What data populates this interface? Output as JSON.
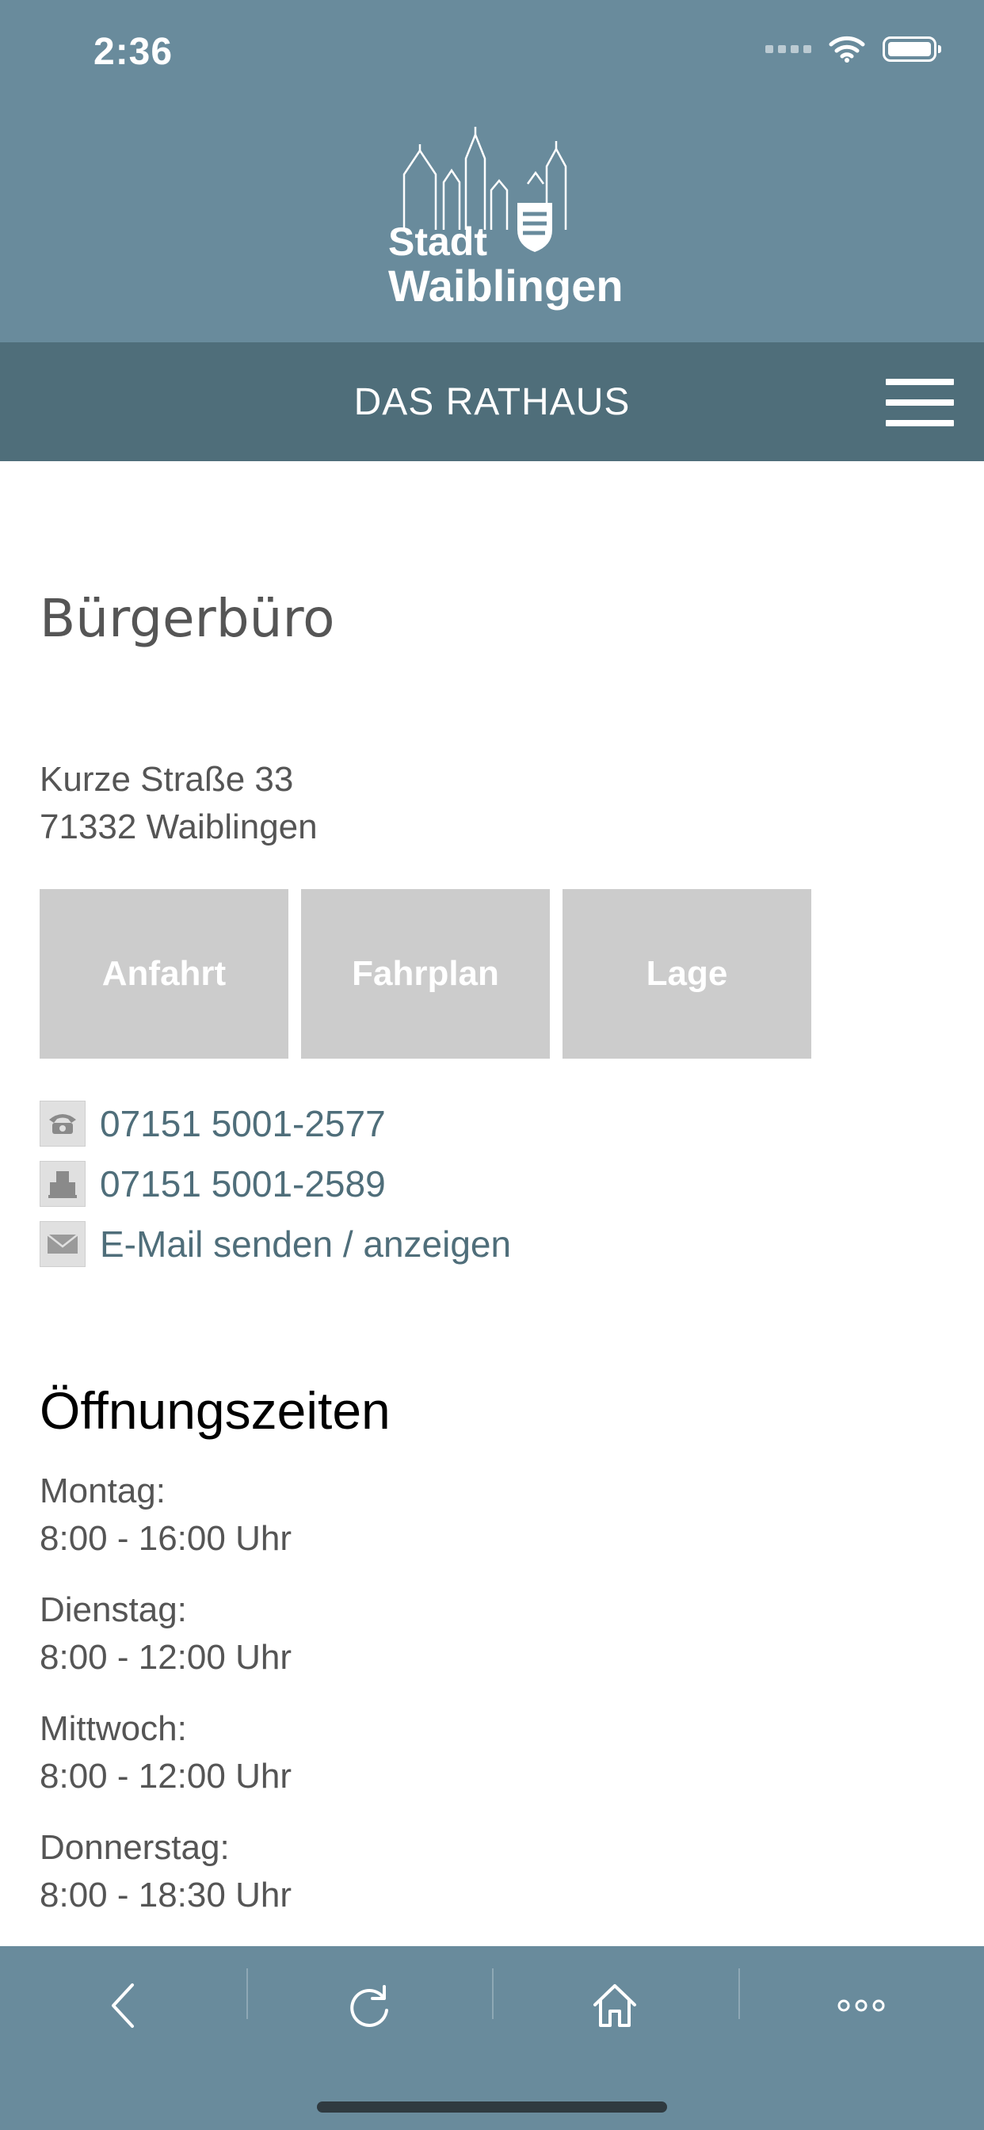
{
  "status_bar": {
    "time": "2:36"
  },
  "logo": {
    "line1": "Stadt",
    "line2": "Waiblingen"
  },
  "nav": {
    "title": "DAS RATHAUS"
  },
  "page": {
    "title": "Bürgerbüro",
    "address": [
      "Kurze Straße 33",
      "71332 Waiblingen"
    ],
    "buttons": {
      "anfahrt": "Anfahrt",
      "fahrplan": "Fahrplan",
      "lage": "Lage"
    },
    "contacts": {
      "phone": "07151 5001-2577",
      "fax": "07151 5001-2589",
      "email": "E-Mail senden / anzeigen"
    },
    "hours_title": "Öffnungszeiten",
    "hours": [
      {
        "day": "Montag:",
        "time": "8:00 - 16:00 Uhr"
      },
      {
        "day": "Dienstag:",
        "time": "8:00 - 12:00 Uhr"
      },
      {
        "day": "Mittwoch:",
        "time": "8:00 - 12:00 Uhr"
      },
      {
        "day": "Donnerstag:",
        "time": "8:00 - 18:30 Uhr"
      }
    ]
  },
  "colors": {
    "header": "#698b9c",
    "nav": "#4f6e7a",
    "link": "#4f6e7a",
    "button": "#cccccc",
    "text": "#555555"
  },
  "icons": {
    "phone": "phone-icon",
    "fax": "fax-icon",
    "email": "envelope-icon",
    "back": "chevron-left-icon",
    "reload": "reload-icon",
    "home": "home-icon",
    "more": "more-icon",
    "menu": "hamburger-icon"
  }
}
